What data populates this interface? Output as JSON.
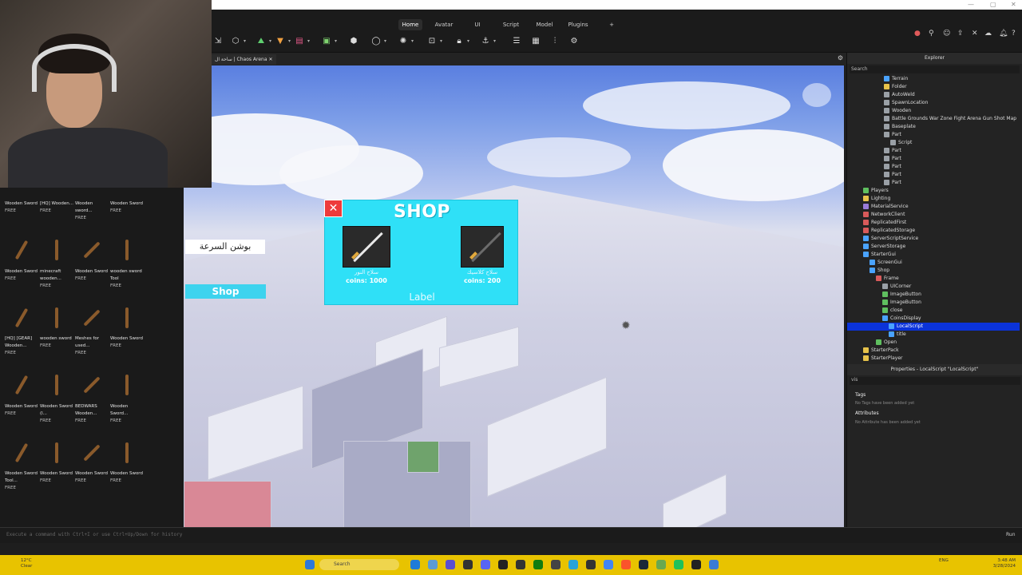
{
  "ribbon": {
    "tabs": [
      "Home",
      "Avatar",
      "UI",
      "Script",
      "Model",
      "Plugins"
    ],
    "active_tab": "Home",
    "add_tab": "+"
  },
  "document_tab": {
    "title": "ساحة ال | Chaos Arena"
  },
  "viewport_gui": {
    "potion_label": "بوشن السرعة",
    "shop_button": "Shop",
    "shop_frame": {
      "title": "SHOP",
      "close_symbol": "✕",
      "label": "Label",
      "items": [
        {
          "name": "سلاح النور",
          "price": "coins: 1000"
        },
        {
          "name": "سلاح كلاسيك",
          "price": "coins: 200"
        }
      ]
    }
  },
  "toolbox": {
    "items": [
      {
        "name": "Wooden Sword",
        "tag": "FREE"
      },
      {
        "name": "[HQ] Wooden...",
        "tag": "FREE"
      },
      {
        "name": "Wooden sword...",
        "tag": "FREE"
      },
      {
        "name": "Wooden Sword",
        "tag": "FREE"
      },
      {
        "name": "Wooden Sword",
        "tag": "FREE"
      },
      {
        "name": "minecraft wooden...",
        "tag": "FREE"
      },
      {
        "name": "Wooden Sword",
        "tag": "FREE"
      },
      {
        "name": "wooden sword Tool",
        "tag": "FREE"
      },
      {
        "name": "[HQ] [GEAR] Wooden...",
        "tag": "FREE"
      },
      {
        "name": "wooden sword",
        "tag": "FREE"
      },
      {
        "name": "Meshes for used...",
        "tag": "FREE"
      },
      {
        "name": "Wooden Sword",
        "tag": "FREE"
      },
      {
        "name": "Wooden Sword",
        "tag": "FREE"
      },
      {
        "name": "Wooden Sword (l...",
        "tag": "FREE"
      },
      {
        "name": "BEDWARS Wooden...",
        "tag": "FREE"
      },
      {
        "name": "Wooden Sword...",
        "tag": "FREE"
      },
      {
        "name": "Wooden Sword Tool...",
        "tag": "FREE"
      },
      {
        "name": "Wooden Sword",
        "tag": "FREE"
      },
      {
        "name": "Wooden Sword",
        "tag": "FREE"
      },
      {
        "name": "Wooden Sword",
        "tag": "FREE"
      }
    ]
  },
  "explorer": {
    "title": "Explorer",
    "search_placeholder": "Search",
    "rows": [
      {
        "label": "Terrain",
        "color": "#4aa3ff"
      },
      {
        "label": "Folder",
        "color": "#e6c24a"
      },
      {
        "label": "AutoWeld",
        "color": "#9aa0a6"
      },
      {
        "label": "SpawnLocation",
        "color": "#9aa0a6"
      },
      {
        "label": "Wooden",
        "color": "#9aa0a6"
      },
      {
        "label": "Battle Grounds War Zone Fight Arena Gun Shot Map",
        "color": "#9aa0a6"
      },
      {
        "label": "Baseplate",
        "color": "#9aa0a6"
      },
      {
        "label": "Part",
        "color": "#9aa0a6"
      },
      {
        "label": "Script",
        "color": "#9aa0a6"
      },
      {
        "label": "Part",
        "color": "#9aa0a6"
      },
      {
        "label": "Part",
        "color": "#9aa0a6"
      },
      {
        "label": "Part",
        "color": "#9aa0a6"
      },
      {
        "label": "Part",
        "color": "#9aa0a6"
      },
      {
        "label": "Part",
        "color": "#9aa0a6"
      },
      {
        "label": "Players",
        "color": "#5fbf5f"
      },
      {
        "label": "Lighting",
        "color": "#e6c24a"
      },
      {
        "label": "MaterialService",
        "color": "#9a7bd8"
      },
      {
        "label": "NetworkClient",
        "color": "#d85a5a"
      },
      {
        "label": "ReplicatedFirst",
        "color": "#d85a5a"
      },
      {
        "label": "ReplicatedStorage",
        "color": "#d85a5a"
      },
      {
        "label": "ServerScriptService",
        "color": "#4aa3ff"
      },
      {
        "label": "ServerStorage",
        "color": "#4aa3ff"
      },
      {
        "label": "StarterGui",
        "color": "#4aa3ff"
      },
      {
        "label": "ScreenGui",
        "color": "#4aa3ff"
      },
      {
        "label": "Shop",
        "color": "#4aa3ff"
      },
      {
        "label": "Frame",
        "color": "#d85a5a"
      },
      {
        "label": "UICorner",
        "color": "#9aa0a6"
      },
      {
        "label": "ImageButton",
        "color": "#5fbf5f"
      },
      {
        "label": "ImageButton",
        "color": "#5fbf5f"
      },
      {
        "label": "close",
        "color": "#5fbf5f"
      },
      {
        "label": "CoinsDisplay",
        "color": "#4aa3ff"
      },
      {
        "label": "LocalScript",
        "color": "#4aa3ff"
      },
      {
        "label": "title",
        "color": "#4aa3ff"
      },
      {
        "label": "Open",
        "color": "#5fbf5f"
      },
      {
        "label": "StarterPack",
        "color": "#e6c24a"
      },
      {
        "label": "StarterPlayer",
        "color": "#e6c24a"
      }
    ],
    "selected": "LocalScript"
  },
  "properties": {
    "title": "Properties - LocalScript \"LocalScript\"",
    "filter": "vis",
    "tags_header": "Tags",
    "tags_empty": "No Tags have been added yet",
    "attributes_header": "Attributes",
    "attributes_empty": "No Attribute has been added yet"
  },
  "command_bar": {
    "placeholder": "Execute a command with Ctrl+I or use Ctrl+Up/Down for history",
    "run_label": "Run"
  },
  "taskbar": {
    "weather_temp": "12°C",
    "weather_desc": "Clear",
    "search_label": "Search",
    "lang": "ENG",
    "time": "3:48 AM",
    "date": "3/28/2024"
  }
}
